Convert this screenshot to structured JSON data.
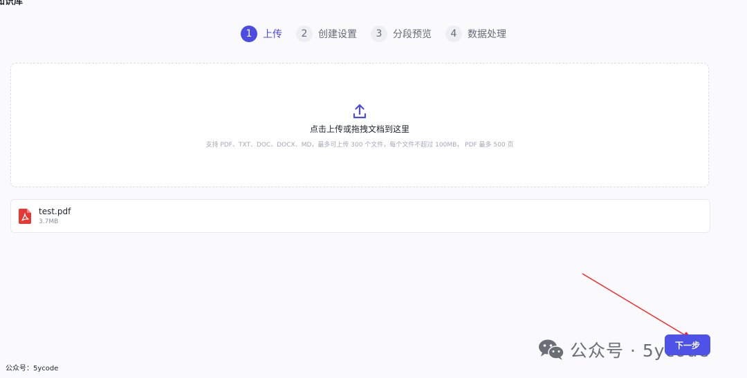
{
  "page": {
    "title": "知识库"
  },
  "steps": [
    {
      "num": "1",
      "label": "上传",
      "active": true
    },
    {
      "num": "2",
      "label": "创建设置",
      "active": false
    },
    {
      "num": "3",
      "label": "分段预览",
      "active": false
    },
    {
      "num": "4",
      "label": "数据处理",
      "active": false
    }
  ],
  "dropzone": {
    "icon": "upload-icon",
    "text": "点击上传或拖拽文档到这里",
    "hint": "支持 PDF、TXT、DOC、DOCX、MD，最多可上传 300 个文件，每个文件不超过 100MB， PDF 最多 500 页"
  },
  "files": [
    {
      "icon": "pdf-file-icon",
      "name": "test.pdf",
      "size": "3.7MB"
    }
  ],
  "actions": {
    "next_label": "下一步"
  },
  "watermark": {
    "icon": "wechat-icon",
    "text": "公众号 · 5ycode"
  },
  "footer": {
    "note": "公众号：5ycode"
  },
  "colors": {
    "accent": "#4c4ce0",
    "annotation_arrow": "#ff2020",
    "pdf_red": "#e53935"
  }
}
